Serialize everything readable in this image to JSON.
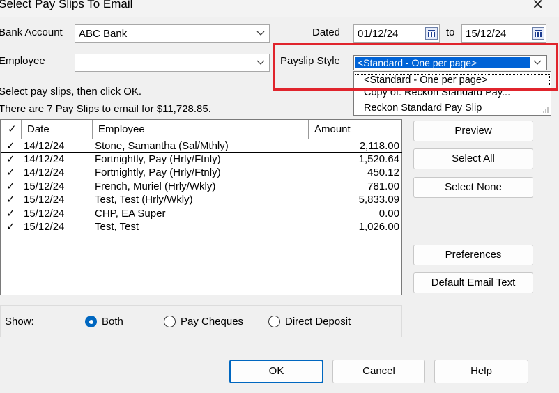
{
  "window": {
    "title": "Select Pay Slips To Email",
    "close_symbol": "✕"
  },
  "form": {
    "bank_account_label": "Bank Account",
    "bank_account_value": "ABC Bank",
    "employee_label": "Employee",
    "employee_value": "",
    "dated_label": "Dated",
    "date_from": "01/12/24",
    "to_label": "to",
    "date_to": "15/12/24",
    "payslip_style_label": "Payslip Style",
    "payslip_style_value": "<Standard - One per page>",
    "payslip_style_options": [
      "<Standard - One per page>",
      "Copy of: Reckon Standard Pay...",
      "Reckon Standard Pay Slip"
    ]
  },
  "instructions": {
    "line1": "Select pay slips, then click OK.",
    "line2": "There are 7 Pay Slips to email for $11,728.85."
  },
  "table": {
    "check_header": "✓",
    "columns": [
      "Date",
      "Employee",
      "Amount"
    ],
    "rows": [
      {
        "check": "✓",
        "date": "14/12/24",
        "employee": "Stone, Samantha (Sal/Mthly)",
        "amount": "2,118.00"
      },
      {
        "check": "✓",
        "date": "14/12/24",
        "employee": "Fortnightly, Pay (Hrly/Ftnly)",
        "amount": "1,520.64"
      },
      {
        "check": "✓",
        "date": "14/12/24",
        "employee": "Fortnightly, Pay (Hrly/Ftnly)",
        "amount": "450.12"
      },
      {
        "check": "✓",
        "date": "15/12/24",
        "employee": "French, Muriel (Hrly/Wkly)",
        "amount": "781.00"
      },
      {
        "check": "✓",
        "date": "15/12/24",
        "employee": "Test, Test (Hrly/Wkly)",
        "amount": "5,833.09"
      },
      {
        "check": "✓",
        "date": "15/12/24",
        "employee": "CHP, EA Super",
        "amount": "0.00"
      },
      {
        "check": "✓",
        "date": "15/12/24",
        "employee": "Test, Test",
        "amount": "1,026.00"
      }
    ]
  },
  "side_buttons": {
    "preview": "Preview",
    "select_all": "Select All",
    "select_none": "Select None",
    "preferences": "Preferences",
    "default_email_text": "Default Email Text"
  },
  "show": {
    "label": "Show:",
    "options": [
      "Both",
      "Pay Cheques",
      "Direct Deposit"
    ],
    "selected": "Both"
  },
  "footer": {
    "ok": "OK",
    "cancel": "Cancel",
    "help": "Help"
  },
  "colors": {
    "highlight": "#e0242c",
    "selection": "#0063d6",
    "accent": "#0067c0"
  }
}
